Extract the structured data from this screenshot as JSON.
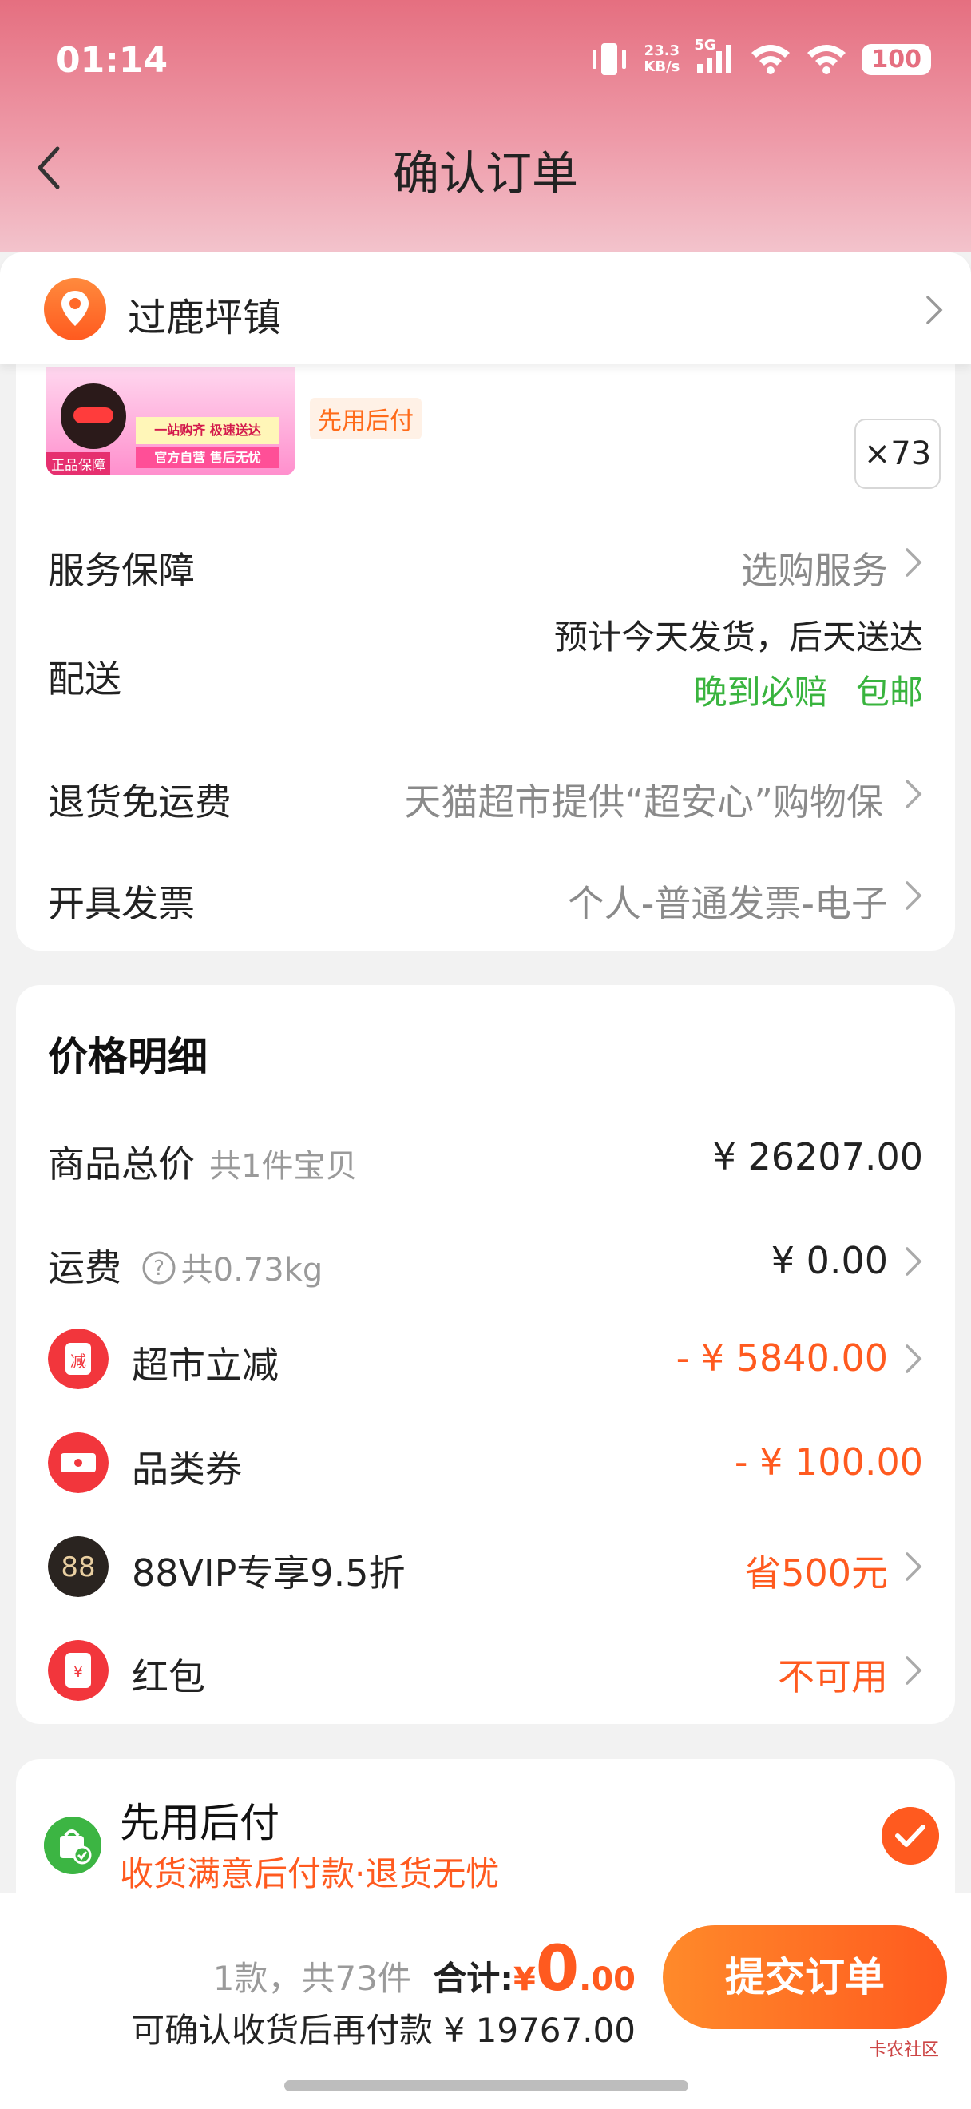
{
  "status_bar": {
    "time": "01:14",
    "net_speed_top": "23.3",
    "net_speed_bottom": "KB/s",
    "network": "5G",
    "battery": "100"
  },
  "nav": {
    "title": "确认订单"
  },
  "address": {
    "text": "过鹿坪镇"
  },
  "product": {
    "image_badge": "正品保障",
    "image_band_top": "一站购齐 极速送达",
    "image_band_bottom": "官方自营 售后无忧",
    "pay_later_tag": "先用后付",
    "quantity": "×73"
  },
  "order_rows": {
    "service_label": "服务保障",
    "service_value": "选购服务",
    "delivery_label": "配送",
    "delivery_line1": "预计今天发货，后天送达",
    "delivery_line2a": "晚到必赔",
    "delivery_line2b": "包邮",
    "return_label": "退货免运费",
    "return_value": "天猫超市提供“超安心”购物保",
    "invoice_label": "开具发票",
    "invoice_value": "个人-普通发票-电子"
  },
  "price_detail": {
    "title": "价格明细",
    "items_total_label": "商品总价",
    "items_total_sub": "共1件宝贝",
    "items_total_value": "¥ 26207.00",
    "shipping_label": "运费",
    "shipping_sub": "共0.73kg",
    "shipping_value": "¥ 0.00",
    "market_discount_label": "超市立减",
    "market_discount_value": "- ¥ 5840.00",
    "category_coupon_label": "品类券",
    "category_coupon_value": "- ¥ 100.00",
    "vip_label": "88VIP专享9.5折",
    "vip_value": "省500元",
    "red_packet_label": "红包",
    "red_packet_value": "不可用"
  },
  "pay_later": {
    "title": "先用后付",
    "subtitle": "收货满意后付款·退货无忧"
  },
  "footer": {
    "count_text": "1款，共73件",
    "total_label": "合计:",
    "currency": "¥",
    "total_int": "0",
    "total_dec": ".00",
    "later_text": "可确认收货后再付款 ¥ 19767.00",
    "submit_label": "提交订单",
    "watermark": "卡农社区"
  },
  "colors": {
    "accent": "#ff5a1f",
    "green": "#39b43e",
    "header_pink": "#e56f80"
  }
}
